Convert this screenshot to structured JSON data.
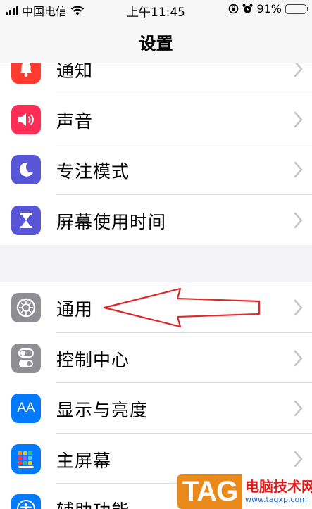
{
  "status_bar": {
    "carrier": "中国电信",
    "time": "上午11:45",
    "battery": "91%",
    "battery_level": 0.91
  },
  "nav": {
    "title": "设置"
  },
  "group1": [
    {
      "label": "通知",
      "icon": "bell-icon",
      "color": "#ff3b30"
    },
    {
      "label": "声音",
      "icon": "speaker-icon",
      "color": "#ff2d55"
    },
    {
      "label": "专注模式",
      "icon": "moon-icon",
      "color": "#5856d6"
    },
    {
      "label": "屏幕使用时间",
      "icon": "hourglass-icon",
      "color": "#5856d6"
    }
  ],
  "group2": [
    {
      "label": "通用",
      "icon": "gear-icon",
      "color": "#8e8e93"
    },
    {
      "label": "控制中心",
      "icon": "toggles-icon",
      "color": "#8e8e93"
    },
    {
      "label": "显示与亮度",
      "icon": "text-size-icon",
      "color": "#007aff",
      "icon_text": "AA"
    },
    {
      "label": "主屏幕",
      "icon": "home-grid-icon",
      "color": "#007aff"
    },
    {
      "label": "辅助功能",
      "icon": "accessibility-icon",
      "color": "#007aff"
    }
  ],
  "annotation": {
    "color": "#e0282b"
  },
  "watermark": {
    "tag": "TAG",
    "site_name": "电脑技术网",
    "site_url": "www.tagxp.com"
  }
}
